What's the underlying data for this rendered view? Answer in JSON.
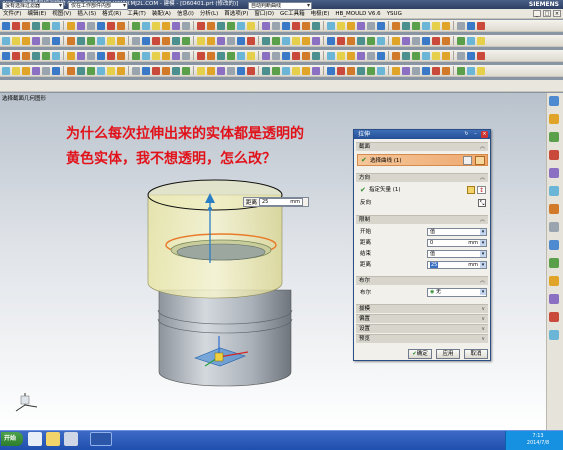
{
  "window": {
    "title": "NX 5 - 优胜模具培训学校  0769-88031080  WWW.MJ2L.COM - 建模 - [D60401.prt (修改的)]",
    "brand": "SIEMENS"
  },
  "menu": [
    "文件(F)",
    "编辑(E)",
    "视图(V)",
    "插入(S)",
    "格式(R)",
    "工具(T)",
    "装配(A)",
    "信息(I)",
    "分析(L)",
    "首选项(P)",
    "窗口(O)",
    "GC工具箱",
    "电极(E)",
    "HB_MOULD V6.6",
    "YSUG"
  ],
  "window_controls": [
    "_",
    "□",
    "×"
  ],
  "filter": {
    "selection": "没有选择过滤器",
    "scope": "仅在工作部件内部",
    "snap": "自动判断曲线"
  },
  "viewport": {
    "label": "选择截面几何图形"
  },
  "question": {
    "line1": "为什么每次拉伸出来的实体都是透明的",
    "line2": "黄色实体，我不想透明，怎么改？"
  },
  "distance_popup": {
    "label": "距离",
    "value": "25",
    "unit": "mm"
  },
  "dialog": {
    "title": "拉伸",
    "sections": {
      "section": "截面",
      "direction": "方向",
      "limits": "限制",
      "boolean": "布尔",
      "draft": "拔模",
      "offset": "偏置",
      "settings": "设置",
      "preview": "预览"
    },
    "select_curve": "选择曲线 (1)",
    "specify_vector": "指定矢量 (1)",
    "reverse": "反向",
    "limits": {
      "start_label": "开始",
      "start_value": "值",
      "start_dist_label": "距离",
      "start_dist_value": "0",
      "end_label": "结束",
      "end_value": "值",
      "end_dist_label": "距离",
      "end_dist_value": "25",
      "unit": "mm"
    },
    "boolean": {
      "label": "布尔",
      "value": "无"
    },
    "buttons": {
      "ok": "确定",
      "apply": "应用",
      "cancel": "取消"
    }
  },
  "taskbar": {
    "start": "开始",
    "time": "7:13",
    "date": "2014/7/8"
  },
  "colors": {
    "solid_yellow": "#efecb0",
    "solid_gray": "#b8bfc6",
    "error_text": "#e2121a",
    "dialog_header": "#2f5ea6"
  }
}
